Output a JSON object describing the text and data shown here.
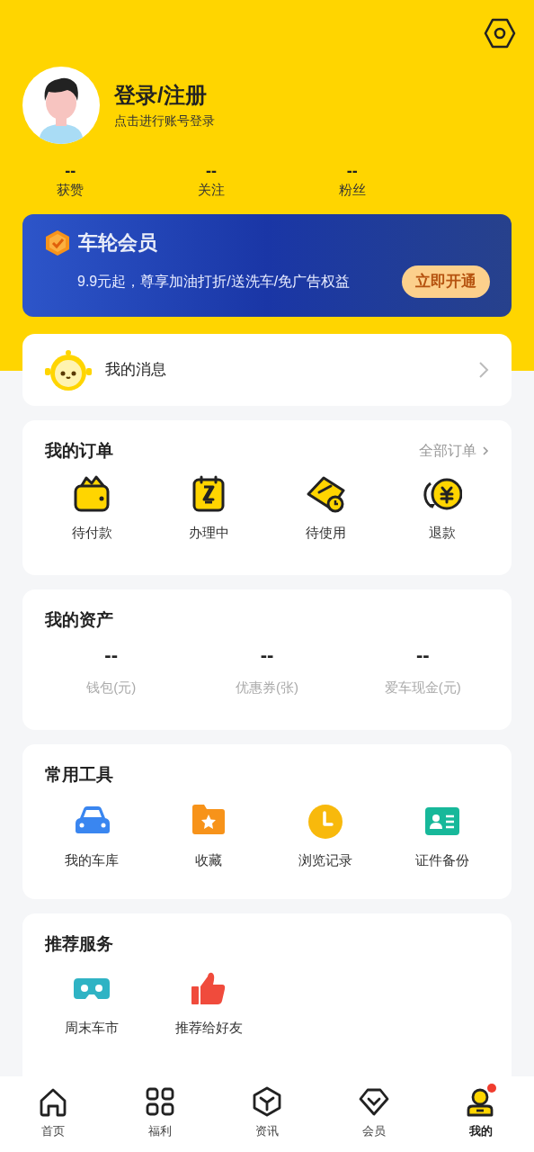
{
  "header": {
    "title": "登录/注册",
    "subtitle": "点击进行账号登录"
  },
  "stats": [
    {
      "value": "--",
      "label": "获赞"
    },
    {
      "value": "--",
      "label": "关注"
    },
    {
      "value": "--",
      "label": "粉丝"
    }
  ],
  "membership": {
    "title": "车轮会员",
    "description": "9.9元起，尊享加油打折/送洗车/免广告权益",
    "button": "立即开通"
  },
  "messages": {
    "label": "我的消息"
  },
  "orders": {
    "title": "我的订单",
    "link": "全部订单",
    "items": [
      {
        "kind": "wallet",
        "label": "待付款"
      },
      {
        "kind": "hourglass",
        "label": "办理中"
      },
      {
        "kind": "ticket",
        "label": "待使用"
      },
      {
        "kind": "refund",
        "label": "退款"
      }
    ]
  },
  "assets": {
    "title": "我的资产",
    "items": [
      {
        "value": "--",
        "label": "钱包(元)"
      },
      {
        "value": "--",
        "label": "优惠券(张)"
      },
      {
        "value": "--",
        "label": "爱车现金(元)"
      }
    ]
  },
  "tools": {
    "title": "常用工具",
    "items": [
      {
        "kind": "car",
        "label": "我的车库"
      },
      {
        "kind": "folder",
        "label": "收藏"
      },
      {
        "kind": "clock",
        "label": "浏览记录"
      },
      {
        "kind": "id-card",
        "label": "证件备份"
      }
    ]
  },
  "recommended": {
    "title": "推荐服务",
    "items": [
      {
        "kind": "vr",
        "label": "周末车市"
      },
      {
        "kind": "thumbs-up",
        "label": "推荐给好友"
      }
    ]
  },
  "tab_bar": [
    {
      "kind": "home",
      "label": "首页",
      "selected": false,
      "notification_dot": false
    },
    {
      "kind": "grid",
      "label": "福利",
      "selected": false,
      "notification_dot": false
    },
    {
      "kind": "cube",
      "label": "资讯",
      "selected": false,
      "notification_dot": false
    },
    {
      "kind": "diamond",
      "label": "会员",
      "selected": false,
      "notification_dot": false
    },
    {
      "kind": "profile",
      "label": "我的",
      "selected": true,
      "notification_dot": true
    }
  ]
}
